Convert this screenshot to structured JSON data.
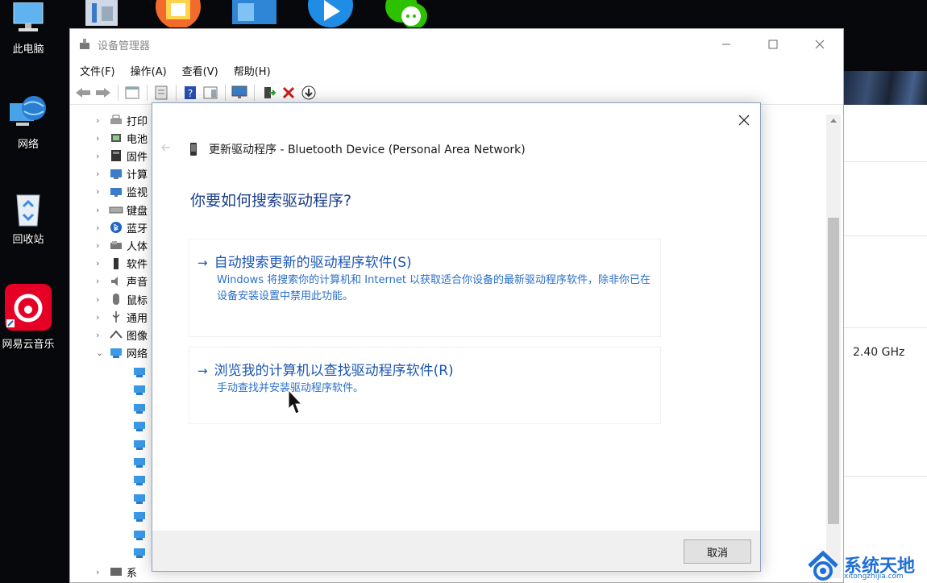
{
  "desktop": {
    "icons": [
      {
        "label": "此电脑"
      },
      {
        "label": "网络"
      },
      {
        "label": "回收站"
      },
      {
        "label": "网易云音乐"
      }
    ],
    "side_panel_value": "2.40 GHz"
  },
  "device_manager": {
    "title": "设备管理器",
    "menu": [
      "文件(F)",
      "操作(A)",
      "查看(V)",
      "帮助(H)"
    ],
    "tree": [
      {
        "label": "打印",
        "icon": "printer-icon",
        "expanded": false
      },
      {
        "label": "电池",
        "icon": "battery-icon",
        "expanded": false
      },
      {
        "label": "固件",
        "icon": "firmware-icon",
        "expanded": false
      },
      {
        "label": "计算",
        "icon": "computer-icon",
        "expanded": false
      },
      {
        "label": "监视",
        "icon": "monitor-icon",
        "expanded": false
      },
      {
        "label": "键盘",
        "icon": "keyboard-icon",
        "expanded": false
      },
      {
        "label": "蓝牙",
        "icon": "bluetooth-icon",
        "expanded": false
      },
      {
        "label": "人体",
        "icon": "hid-icon",
        "expanded": false
      },
      {
        "label": "软件",
        "icon": "software-device-icon",
        "expanded": false
      },
      {
        "label": "声音",
        "icon": "sound-icon",
        "expanded": false
      },
      {
        "label": "鼠标",
        "icon": "mouse-icon",
        "expanded": false
      },
      {
        "label": "通用",
        "icon": "usb-icon",
        "expanded": false
      },
      {
        "label": "图像",
        "icon": "camera-icon",
        "expanded": false
      },
      {
        "label": "网络",
        "icon": "network-adapter-icon",
        "expanded": true
      }
    ],
    "last_tree_label": "系"
  },
  "dialog": {
    "header": "更新驱动程序 - Bluetooth Device (Personal Area Network)",
    "question": "你要如何搜索驱动程序?",
    "options": [
      {
        "title": "自动搜索更新的驱动程序软件(S)",
        "description": "Windows 将搜索你的计算机和 Internet 以获取适合你设备的最新驱动程序软件，除非你已在设备安装设置中禁用此功能。"
      },
      {
        "title": "浏览我的计算机以查找驱动程序软件(R)",
        "description": "手动查找并安装驱动程序软件。"
      }
    ],
    "cancel_label": "取消"
  },
  "watermark": {
    "main": "系统天地",
    "sub": "xitongzhijia.com"
  }
}
